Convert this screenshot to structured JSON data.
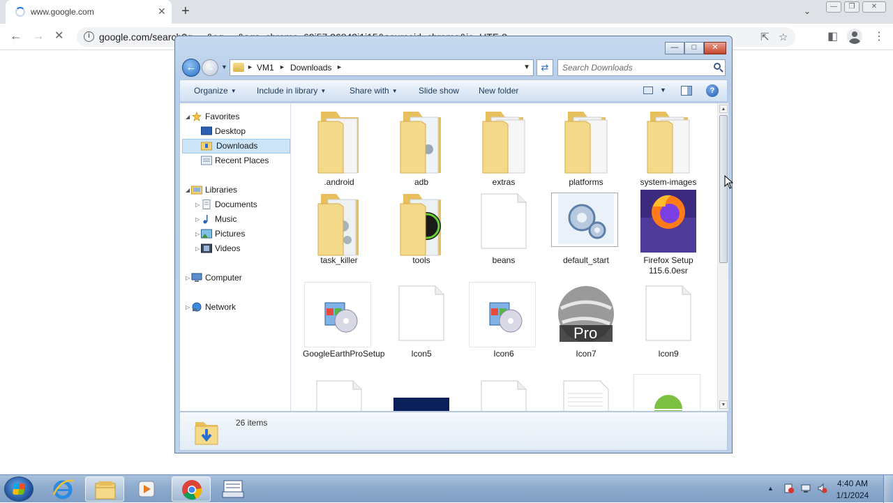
{
  "browser": {
    "tab_title": "www.google.com",
    "tab_close": "✕",
    "new_tab": "+",
    "url": "google.com/search?q=...&oq=...&aqs=chrome..69i57.26842j1j15&sourceid=chrome&ie=UTF-8",
    "window_minimize": "—",
    "window_restore": "❐",
    "window_close": "✕"
  },
  "explorer": {
    "breadcrumb": [
      "VM1",
      "Downloads"
    ],
    "search_placeholder": "Search Downloads",
    "commands": {
      "organize": "Organize",
      "include_in_library": "Include in library",
      "share_with": "Share with",
      "slide_show": "Slide show",
      "new_folder": "New folder"
    },
    "nav": {
      "favorites": "Favorites",
      "desktop": "Desktop",
      "downloads": "Downloads",
      "recent_places": "Recent Places",
      "libraries": "Libraries",
      "documents": "Documents",
      "music": "Music",
      "pictures": "Pictures",
      "videos": "Videos",
      "computer": "Computer",
      "network": "Network"
    },
    "files": [
      {
        "name": ".android",
        "type": "folder"
      },
      {
        "name": "adb",
        "type": "folder"
      },
      {
        "name": "extras",
        "type": "folder"
      },
      {
        "name": "platforms",
        "type": "folder"
      },
      {
        "name": "system-images",
        "type": "folder"
      },
      {
        "name": "task_killer",
        "type": "folder"
      },
      {
        "name": "tools",
        "type": "folder"
      },
      {
        "name": "beans",
        "type": "file"
      },
      {
        "name": "default_start",
        "type": "exe"
      },
      {
        "name": "Firefox Setup 115.6.0esr",
        "type": "exe"
      },
      {
        "name": "GoogleEarthProSetup",
        "type": "installer"
      },
      {
        "name": "Icon5",
        "type": "file"
      },
      {
        "name": "Icon6",
        "type": "installer"
      },
      {
        "name": "Icon7",
        "type": "exe"
      },
      {
        "name": "Icon9",
        "type": "file"
      }
    ],
    "icon7_badge": "Pro",
    "item_count": "26 items"
  },
  "taskbar": {
    "time": "4:40 AM",
    "date": "1/1/2024"
  },
  "colors": {
    "accent": "#1a73e8",
    "selection": "#cce4f7",
    "folder": "#f1d27a",
    "close_red": "#c8462c"
  }
}
